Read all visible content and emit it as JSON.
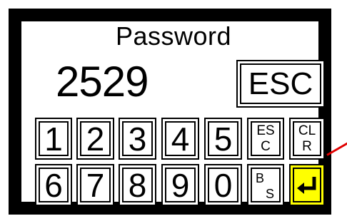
{
  "title": "Password",
  "entered_value": "2529",
  "esc_button_label": "ESC",
  "keypad": {
    "row1": [
      "1",
      "2",
      "3",
      "4",
      "5"
    ],
    "row2": [
      "6",
      "7",
      "8",
      "9",
      "0"
    ],
    "esc_key_label": "ES\nC",
    "clr_key_label": "CL\nR",
    "bs_key_top": "B",
    "bs_key_bottom": "S",
    "enter_icon": "enter-return-arrow-icon"
  },
  "colors": {
    "border": "#000000",
    "background": "#ffffff",
    "enter_key": "#ffff00",
    "pointer": "#e00000"
  }
}
